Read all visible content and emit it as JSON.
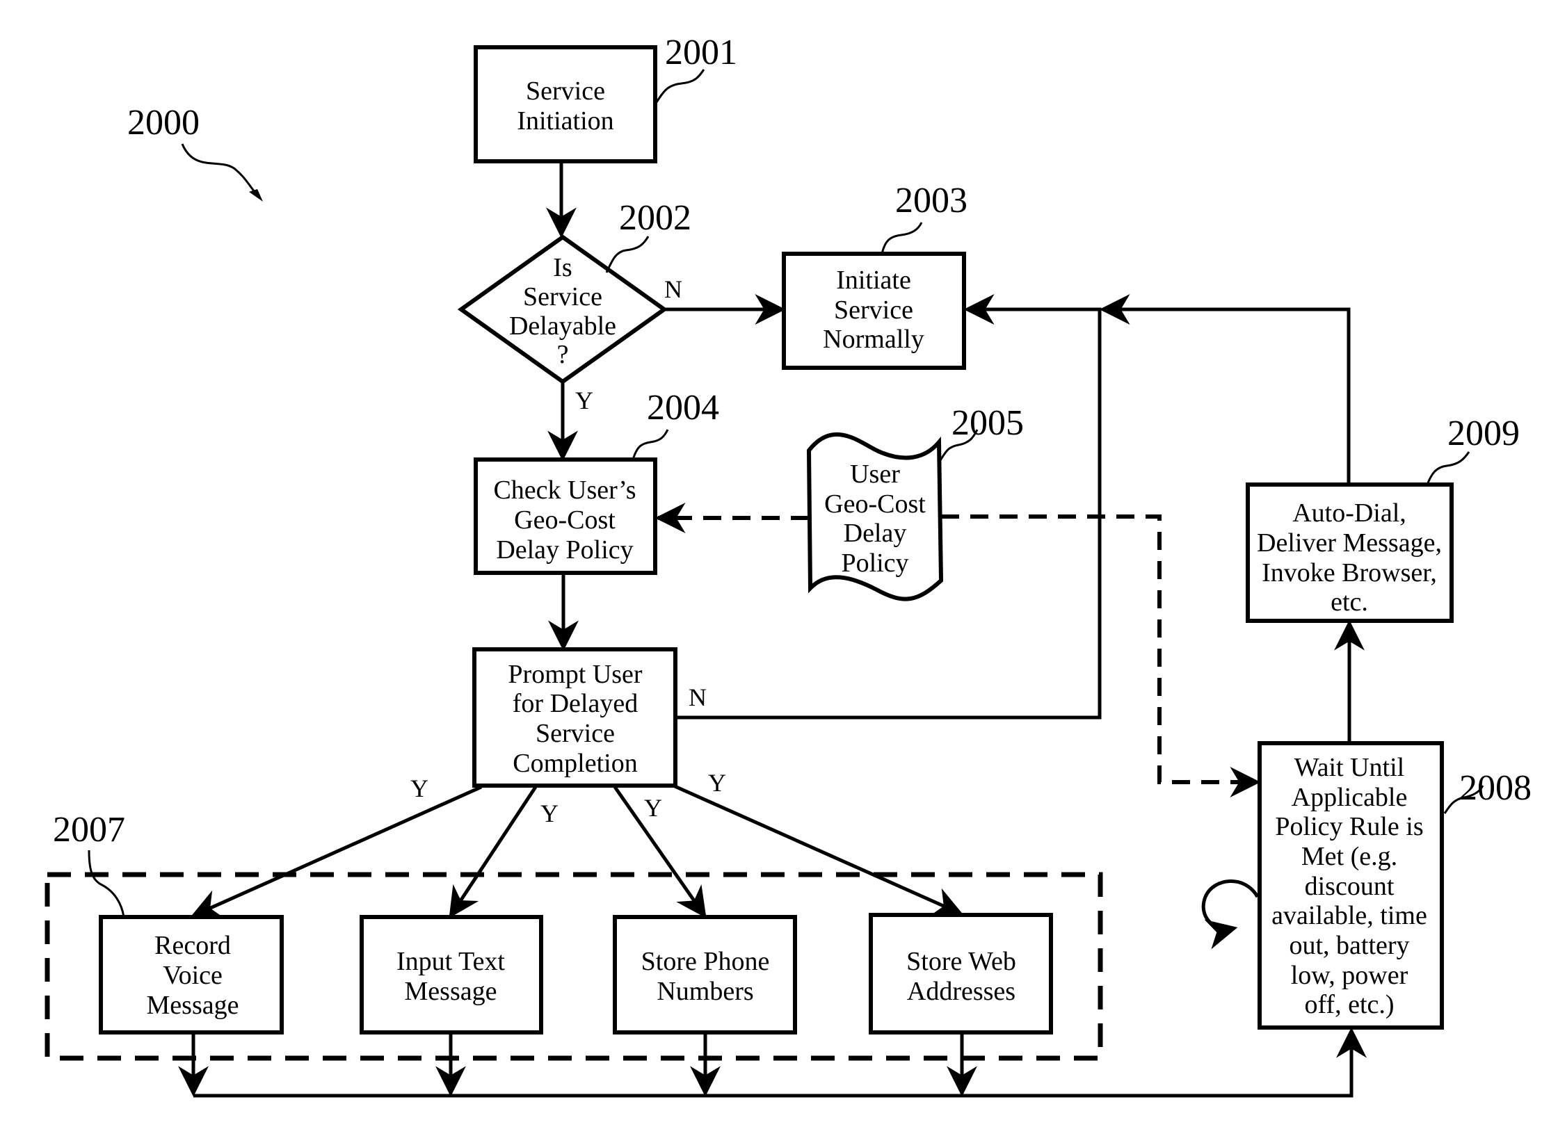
{
  "figure": {
    "ref": "2000",
    "nodes": {
      "n2001": {
        "ref": "2001",
        "lines": [
          "Service",
          "Initiation"
        ]
      },
      "n2002": {
        "ref": "2002",
        "lines": [
          "Is",
          "Service",
          "Delayable",
          "?"
        ]
      },
      "n2003": {
        "ref": "2003",
        "lines": [
          "Initiate",
          "Service",
          "Normally"
        ]
      },
      "n2004": {
        "ref": "2004",
        "lines": [
          "Check User’s",
          "Geo-Cost",
          "Delay Policy"
        ]
      },
      "n2005": {
        "ref": "2005",
        "lines": [
          "User",
          "Geo-Cost",
          "Delay",
          "Policy"
        ]
      },
      "prompt": {
        "lines": [
          "Prompt User",
          "for Delayed",
          "Service",
          "Completion"
        ]
      },
      "n2007": {
        "ref": "2007"
      },
      "record": {
        "lines": [
          "Record",
          "Voice",
          "Message"
        ]
      },
      "input": {
        "lines": [
          "Input Text",
          "Message"
        ]
      },
      "phone": {
        "lines": [
          "Store Phone",
          "Numbers"
        ]
      },
      "web": {
        "lines": [
          "Store Web",
          "Addresses"
        ]
      },
      "n2008": {
        "ref": "2008",
        "lines": [
          "Wait Until",
          "Applicable",
          "Policy Rule is",
          "Met (e.g.",
          "discount",
          "available, time",
          "out, battery",
          "low, power",
          "off, etc.)"
        ]
      },
      "n2009": {
        "ref": "2009",
        "lines": [
          "Auto-Dial,",
          "Deliver Message,",
          "Invoke Browser,",
          "etc."
        ]
      }
    },
    "edge_labels": {
      "decision_no": "N",
      "decision_yes": "Y",
      "prompt_no": "N",
      "prompt_yes_1": "Y",
      "prompt_yes_2": "Y",
      "prompt_yes_3": "Y",
      "prompt_yes_4": "Y"
    }
  }
}
